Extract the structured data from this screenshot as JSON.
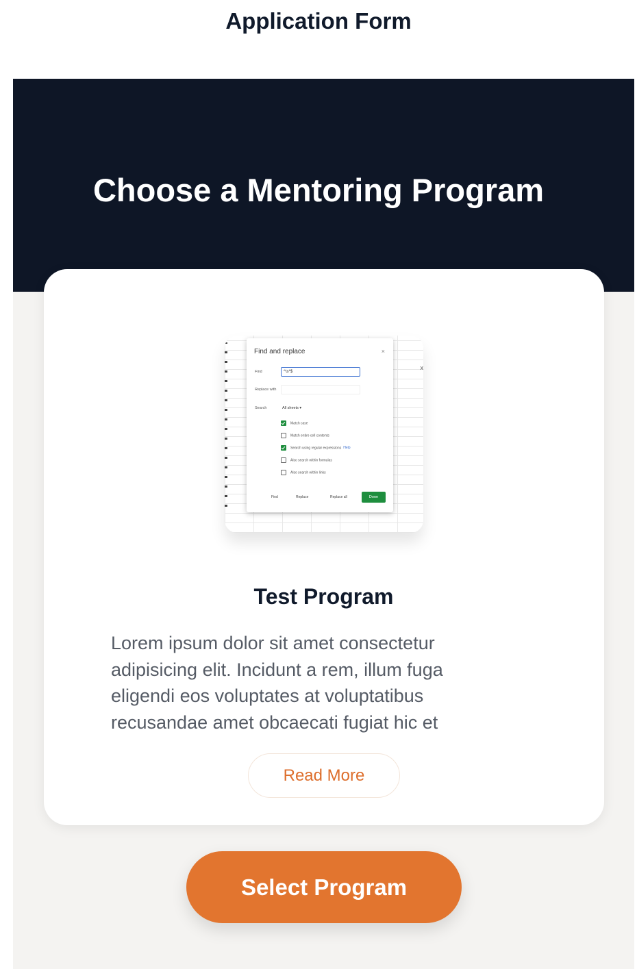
{
  "page": {
    "title": "Application Form"
  },
  "hero": {
    "heading": "Choose a Mentoring Program"
  },
  "program": {
    "name": "Test Program",
    "description": "Lorem ipsum dolor sit amet consectetur adipisicing elit. Incidunt a rem, illum fuga eligendi eos voluptates at voluptatibus recusandae amet obcaecati fugiat hic et",
    "read_more_label": "Read More",
    "thumbnail": {
      "dialog_title": "Find and replace",
      "close_icon": "×",
      "find_label": "Find",
      "find_value": "^\\s*$",
      "replace_label": "Replace with",
      "search_label": "Search",
      "search_value": "All sheets ▾",
      "options": [
        {
          "label": "Match case",
          "checked": true
        },
        {
          "label": "Match entire cell contents",
          "checked": false
        },
        {
          "label": "Search using regular expressions",
          "checked": true
        },
        {
          "label": "Also search within formulas",
          "checked": false
        },
        {
          "label": "Also search within links",
          "checked": false
        }
      ],
      "help_link": "Help",
      "buttons": {
        "find": "Find",
        "replace": "Replace",
        "replace_all": "Replace all",
        "done": "Done"
      },
      "side_mark": "x"
    }
  },
  "actions": {
    "select_program_label": "Select Program"
  },
  "colors": {
    "hero_bg": "#0e1626",
    "page_bg": "#f4f3f1",
    "accent": "#e2752f",
    "accent_text": "#dd6e2c",
    "heading_text": "#101a2b",
    "body_text": "#555b65"
  }
}
